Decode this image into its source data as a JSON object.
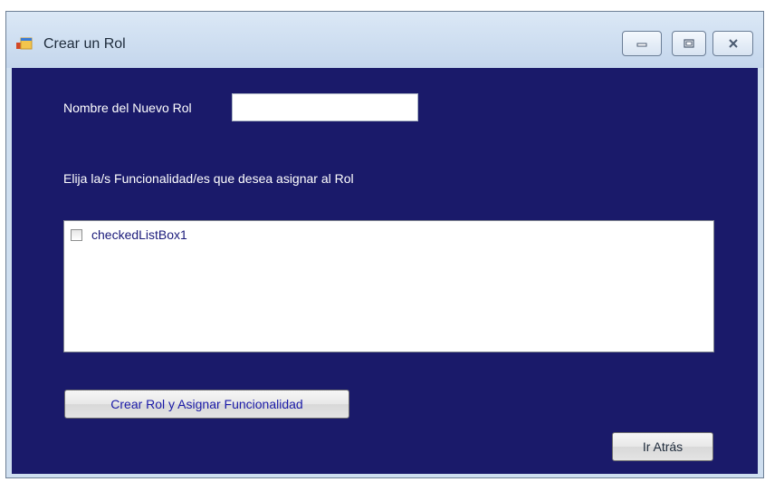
{
  "window": {
    "title": "Crear un Rol",
    "controls": {
      "minimize_icon": "minimize-icon",
      "maximize_icon": "maximize-icon",
      "close_icon": "close-icon"
    },
    "client_bg_color": "#1a1a6a"
  },
  "form": {
    "name_label": "Nombre del Nuevo Rol",
    "name_value": "",
    "instructions": "Elija la/s Funcionalidad/es que desea asignar al Rol",
    "checked_list": {
      "items": [
        {
          "label": "checkedListBox1",
          "checked": false
        }
      ]
    },
    "create_button": "Crear Rol y Asignar Funcionalidad",
    "back_button": "Ir Atrás"
  }
}
